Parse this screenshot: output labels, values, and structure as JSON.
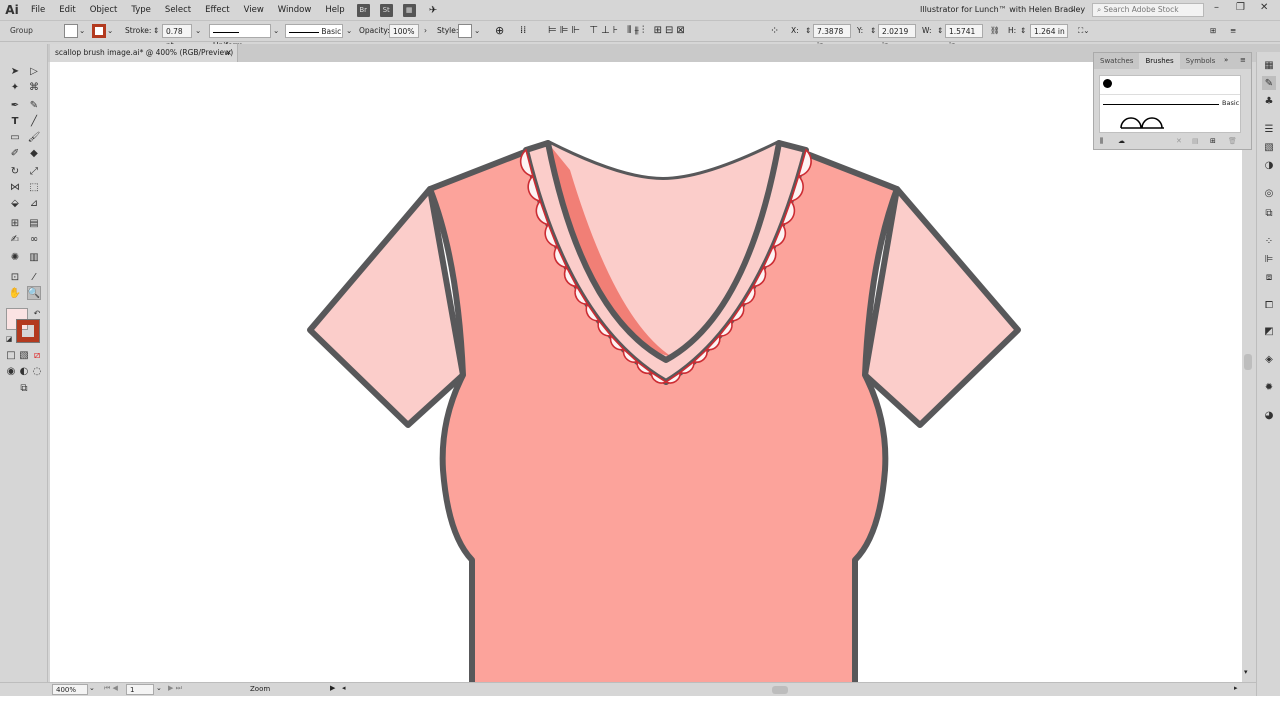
{
  "app": {
    "logo": "Ai",
    "window_title": "Illustrator for Lunch™ with Helen Bradley",
    "search_placeholder": "Search Adobe Stock"
  },
  "menu": [
    "File",
    "Edit",
    "Object",
    "Type",
    "Select",
    "Effect",
    "View",
    "Window",
    "Help"
  ],
  "app_buttons": [
    "Br",
    "St"
  ],
  "control_bar": {
    "selection_label": "Group",
    "stroke_label": "Stroke:",
    "stroke_value": "0.78 pt",
    "profile_label": "Uniform",
    "brush_label": "Basic",
    "opacity_label": "Opacity:",
    "opacity_value": "100%",
    "style_label": "Style:",
    "x_label": "X:",
    "x_value": "7.3878 in",
    "y_label": "Y:",
    "y_value": "2.0219 in",
    "w_label": "W:",
    "w_value": "1.5741 in",
    "h_label": "H:",
    "h_value": "1.264 in"
  },
  "document_tab": {
    "label": "scallop brush image.ai* @ 400% (RGB/Preview)",
    "close": "×"
  },
  "status_bar": {
    "zoom": "400%",
    "artboard": "1",
    "tool": "Zoom"
  },
  "panel": {
    "tabs": [
      "Swatches",
      "Brushes",
      "Symbols"
    ],
    "active_tab": "Brushes",
    "brush_name": "Basic"
  },
  "colors": {
    "fill_swatch": "#fbe3e3",
    "stroke_swatch": "#b33a1f",
    "sleeve": "#fbcdca",
    "body": "#fca39b",
    "inner_neck": "#fbcdca",
    "neck_shadow": "#f17f76",
    "outline": "#58585a",
    "scallop_fill": "#fdf3f3",
    "scallop_stroke": "#cc2c33"
  }
}
